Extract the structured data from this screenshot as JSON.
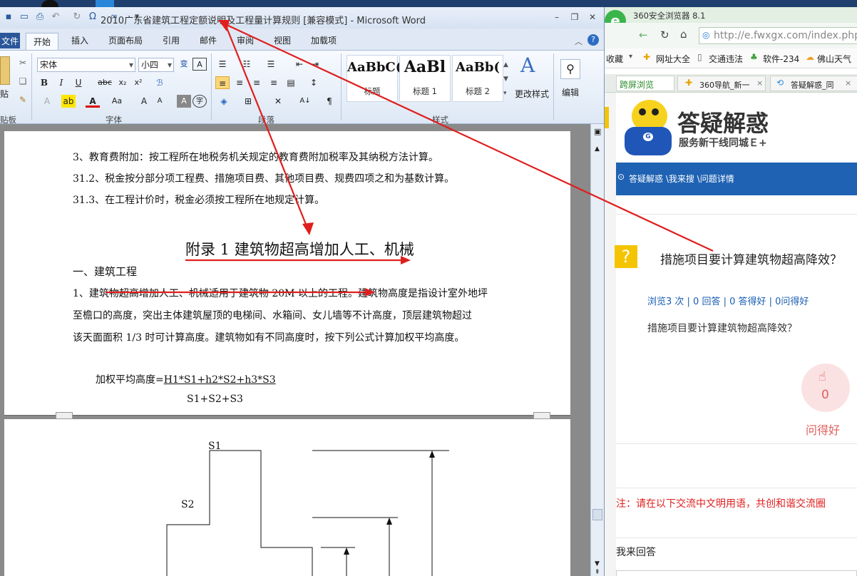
{
  "word": {
    "title": "2010广东省建筑工程定额说明及工程量计算规则 [兼容模式] - Microsoft Word",
    "tabs": [
      "文件",
      "开始",
      "插入",
      "页面布局",
      "引用",
      "邮件",
      "审阅",
      "视图",
      "加载项"
    ],
    "font_name": "宋体",
    "font_size": "小四",
    "groups": {
      "clipboard": "贴板",
      "font": "字体",
      "paragraph": "段落",
      "styles": "样式"
    },
    "clipboard_paste": "贴",
    "styles": [
      {
        "preview": "AaBbC(",
        "name": "标题"
      },
      {
        "preview": "AaBl",
        "name": "标题 1"
      },
      {
        "preview": "AaBb(",
        "name": "标题 2"
      }
    ],
    "change_styles": "更改样式",
    "editing": "编辑",
    "doc": {
      "line1": "3、教育费附加：按工程所在地税务机关规定的教育费附加税率及其纳税方法计算。",
      "line2": "31.2、税金按分部分项工程费、措施项目费、其他项目费、规费四项之和为基数计算。",
      "line3": "31.3、在工程计价时，税金必须按工程所在地规定计算。",
      "heading": "附录 1  建筑物超高增加人工、机械",
      "section": "一、建筑工程",
      "para1": "1、建筑物超高增加人工、机械适用于建筑物 20M 以上的工程。建筑物高度是指设计室外地坪",
      "para2": "至檐口的高度，突出主体建筑屋顶的电梯间、水箱间、女儿墙等不计高度，顶层建筑物超过",
      "para3": "该天面面积 1/3 时可计算高度。建筑物如有不同高度时，按下列公式计算加权平均高度。",
      "formula_label": "加权平均高度=",
      "formula_num": "H1*S1+h2*S2+h3*S3",
      "formula_den": "S1+S2+S3",
      "fig_s1": "S1",
      "fig_s2": "S2"
    }
  },
  "browser": {
    "title": "360安全浏览器 8.1",
    "url": "http://e.fwxgx.com/index.php",
    "bookmarks": [
      "收藏",
      "网址大全",
      "交通违法",
      "软件-234",
      "佛山天气"
    ],
    "tabs": [
      "跨屏浏览",
      "360导航_新一",
      "答疑解惑_同"
    ],
    "brand_title": "答疑解惑",
    "brand_sub": "服务新干线同城Ｅ+",
    "breadcrumb": "答疑解惑 \\我来搜 \\问题详情",
    "question_title": "措施项目要计算建筑物超高降效？",
    "stats": "浏览3 次 | 0 回答 | 0 答得好 | 0问得好",
    "question_body": "措施项目要计算建筑物超高降效？",
    "like_count": "0",
    "like_label": "问得好",
    "notice": "注：请在以下交流中文明用语，共创和谐交流圈",
    "answer_label": "我来回答"
  },
  "colors": {
    "accent_red": "#e01e1e",
    "word_blue": "#2b579a",
    "link_blue": "#1a5fb4",
    "bar_blue": "#1f62b3"
  }
}
